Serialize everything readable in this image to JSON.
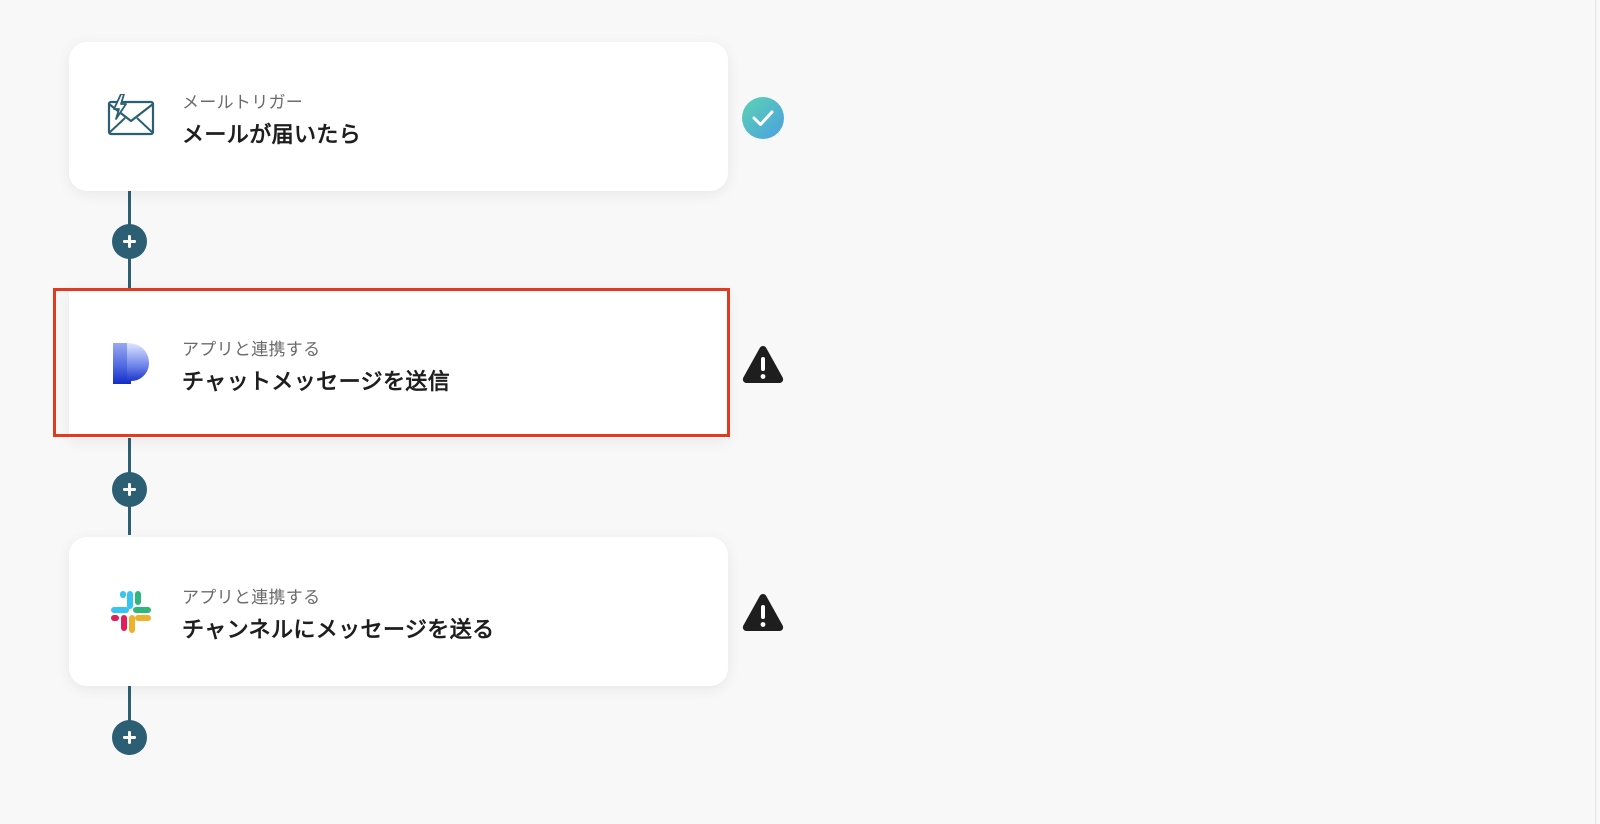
{
  "flow": {
    "steps": [
      {
        "type_label": "メールトリガー",
        "title": "メールが届いたら",
        "icon": "mail-trigger-icon",
        "status": "complete"
      },
      {
        "type_label": "アプリと連携する",
        "title": "チャットメッセージを送信",
        "icon": "app-d-logo-icon",
        "status": "warning",
        "highlighted": true
      },
      {
        "type_label": "アプリと連携する",
        "title": "チャンネルにメッセージを送る",
        "icon": "slack-logo-icon",
        "status": "warning"
      }
    ],
    "add_step_icon": "plus-icon"
  },
  "colors": {
    "connector": "#2c5f73",
    "highlight_border": "#e03a20",
    "check_gradient_start": "#5dd3b0",
    "check_gradient_end": "#4a9fe3",
    "warning": "#1e1e1e"
  }
}
